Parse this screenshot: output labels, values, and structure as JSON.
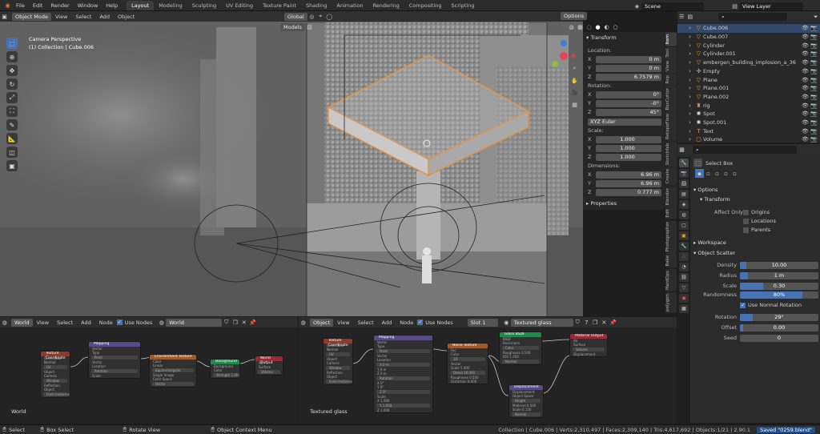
{
  "topbar": {
    "menus": [
      "File",
      "Edit",
      "Render",
      "Window",
      "Help"
    ],
    "workspaces": [
      "Layout",
      "Modeling",
      "Sculpting",
      "UV Editing",
      "Texture Paint",
      "Shading",
      "Animation",
      "Rendering",
      "Compositing",
      "Scripting"
    ],
    "active_workspace": "Layout",
    "scene": "Scene",
    "view_layer": "View Layer"
  },
  "viewport": {
    "mode": "Object Mode",
    "menus": [
      "View",
      "Select",
      "Add",
      "Object"
    ],
    "orientation": "Global",
    "models_label": "Models",
    "options": "Options",
    "camera_text": "Camera Perspective",
    "collection_text": "(1) Collection | Cube.006"
  },
  "npanel": {
    "transform_title": "Transform",
    "location_label": "Location:",
    "location": {
      "x": "0 m",
      "y": "0 m",
      "z": "6.7579 m"
    },
    "rotation_label": "Rotation:",
    "rotation": {
      "x": "0°",
      "y": "-0°",
      "z": "45°"
    },
    "euler": "XYZ Euler",
    "scale_label": "Scale:",
    "scale": {
      "x": "1.000",
      "y": "1.000",
      "z": "1.000"
    },
    "dimensions_label": "Dimensions:",
    "dimensions": {
      "x": "6.96 m",
      "y": "6.96 m",
      "z": "0.777 m"
    },
    "properties_title": "Properties",
    "tabs": [
      "Item",
      "Tool",
      "View",
      "Rep",
      "BoxCutter",
      "RetopoFlow",
      "Sketchfab",
      "Create",
      "Blender",
      "Edit",
      "Photographer",
      "Bake",
      "HardOps",
      "polygon"
    ],
    "axis": [
      "X",
      "Y",
      "Z"
    ]
  },
  "outliner": {
    "items": [
      {
        "name": "Cube.006",
        "selected": true
      },
      {
        "name": "Cube.007",
        "selected": false
      },
      {
        "name": "Cylinder",
        "selected": false
      },
      {
        "name": "Cylinder.001",
        "selected": false
      },
      {
        "name": "embergen_building_implosion_a_36",
        "selected": false
      },
      {
        "name": "Empty",
        "selected": false
      },
      {
        "name": "Plane",
        "selected": false
      },
      {
        "name": "Plane.001",
        "selected": false
      },
      {
        "name": "Plane.002",
        "selected": false
      },
      {
        "name": "rig",
        "selected": false
      },
      {
        "name": "Spot",
        "selected": false
      },
      {
        "name": "Spot.001",
        "selected": false
      },
      {
        "name": "Text",
        "selected": false
      },
      {
        "name": "Volume",
        "selected": false
      }
    ]
  },
  "properties": {
    "tool": "Select Box",
    "options": "Options",
    "transform": "Transform",
    "affect_only": "Affect Only",
    "origins": "Origins",
    "locations": "Locations",
    "parents": "Parents",
    "workspace": "Workspace",
    "object_scatter": "Object Scatter",
    "density_label": "Density",
    "density": "10.00",
    "radius_label": "Radius",
    "radius": "1 m",
    "scale_label": "Scale",
    "scale": "0.30",
    "randomness_label": "Randomness",
    "randomness": "80%",
    "randomness_fraction": 0.8,
    "use_normal_rotation": "Use Normal Rotation",
    "rotation_label": "Rotation",
    "rotation": "29°",
    "offset_label": "Offset",
    "offset": "0.00",
    "seed_label": "Seed",
    "seed": "0"
  },
  "node_world": {
    "editor": "World",
    "menus": [
      "View",
      "Select",
      "Add",
      "Node"
    ],
    "use_nodes": "Use Nodes",
    "world_name": "World",
    "corner_label": "World",
    "nodes": [
      {
        "title": "Texture Coordinate",
        "color": "#8a3b2c",
        "rows": [
          "Generated",
          "Normal",
          "UV",
          "Object",
          "Camera",
          "Window",
          "Reflection",
          "Object",
          "From Instancer"
        ]
      },
      {
        "title": "Mapping",
        "color": "#5a4a8a",
        "rows": [
          "Vector",
          "Type",
          "Point",
          "Vector",
          "Location",
          "Rotation",
          "Scale"
        ]
      },
      {
        "title": "Environment Texture",
        "color": "#a0592a",
        "rows": [
          "Color",
          "Linear",
          "Equirectangular",
          "Single Image",
          "Color Space",
          "Vector"
        ]
      },
      {
        "title": "Background",
        "color": "#1f8a4a",
        "rows": [
          "Background",
          "Color",
          "Strength 1.000"
        ]
      },
      {
        "title": "World Output",
        "color": "#9a2a33",
        "rows": [
          "All",
          "Surface",
          "Volume"
        ]
      }
    ]
  },
  "node_material": {
    "editor": "Object",
    "menus": [
      "View",
      "Select",
      "Add",
      "Node"
    ],
    "use_nodes": "Use Nodes",
    "slot": "Slot 1",
    "material": "Textured glass",
    "corner_label": "Textured glass",
    "nodes": [
      {
        "title": "Texture Coordinate",
        "color": "#8a3b2c",
        "rows": [
          "Generated",
          "Normal",
          "UV",
          "Object",
          "Camera",
          "Window",
          "Reflection",
          "Object",
          "From Instancer"
        ]
      },
      {
        "title": "Mapping",
        "color": "#5a4a8a",
        "rows": [
          "Vector",
          "Type",
          "Point",
          "Vector",
          "Location",
          "X 0 m",
          "Y 0 m",
          "Z 0 m",
          "Rotation",
          "X 0°",
          "Y 0°",
          "Z 0°",
          "Scale",
          "X 1.000",
          "Y 1.000",
          "Z 1.000"
        ]
      },
      {
        "title": "Noise Texture",
        "color": "#a0592a",
        "rows": [
          "Fac",
          "Color",
          "3D",
          "Vector",
          "Scale 5.000",
          "Detail 16.000",
          "Roughness 0.500",
          "Distortion 0.000"
        ]
      },
      {
        "title": "Glass BSDF",
        "color": "#1f8a4a",
        "rows": [
          "BSDF",
          "Beckmann",
          "Color",
          "Roughness 0.500",
          "IOR 1.450",
          "Normal"
        ]
      },
      {
        "title": "Displacement",
        "color": "#5a4a8a",
        "rows": [
          "Displacement",
          "Object Space",
          "Height",
          "Midlevel 0.500",
          "Scale 0.150",
          "Normal"
        ]
      },
      {
        "title": "Material Output",
        "color": "#9a2a33",
        "rows": [
          "All",
          "Surface",
          "Volume",
          "Displacement"
        ]
      }
    ]
  },
  "status": {
    "select": "Select",
    "box_select": "Box Select",
    "rotate_view": "Rotate View",
    "context_menu": "Object Context Menu",
    "stats": "Collection | Cube.006 | Verts:2,310,497 | Faces:2,309,140 | Tris:4,617,692 | Objects:1/21 | 2.90.1",
    "saved": "Saved \"0259.blend\""
  }
}
